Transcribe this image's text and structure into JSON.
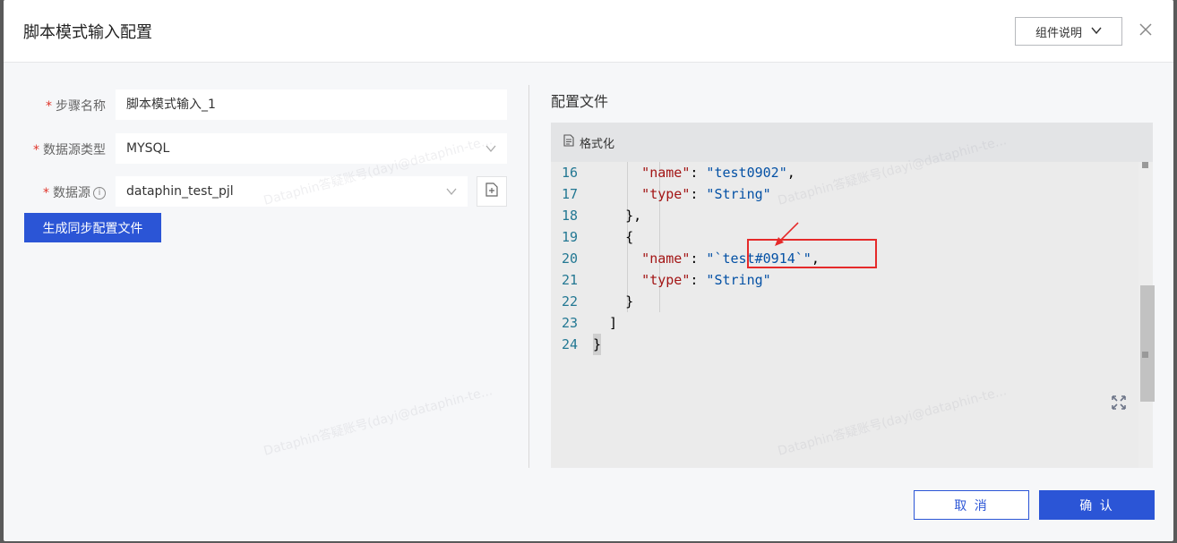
{
  "dialog": {
    "title": "脚本模式输入配置",
    "doc_button": "组件说明",
    "close_icon": "close-icon"
  },
  "form": {
    "step_name": {
      "label": "步骤名称",
      "value": "脚本模式输入_1"
    },
    "datasource_type": {
      "label": "数据源类型",
      "value": "MYSQL"
    },
    "datasource": {
      "label": "数据源",
      "value": "dataphin_test_pjl"
    },
    "generate_button": "生成同步配置文件",
    "required_mark": "*"
  },
  "config": {
    "title": "配置文件",
    "format_button": "格式化",
    "lines": [
      {
        "n": "16",
        "indent": 6,
        "key": "\"name\"",
        "sep": ": ",
        "val": "\"test0902\"",
        "tail": ","
      },
      {
        "n": "17",
        "indent": 6,
        "key": "\"type\"",
        "sep": ": ",
        "val": "\"String\"",
        "tail": ""
      },
      {
        "n": "18",
        "indent": 4,
        "key": "",
        "sep": "",
        "val": "",
        "tail": "},"
      },
      {
        "n": "19",
        "indent": 4,
        "key": "",
        "sep": "",
        "val": "",
        "tail": "{"
      },
      {
        "n": "20",
        "indent": 6,
        "key": "\"name\"",
        "sep": ": ",
        "val": "\"`test#0914`\"",
        "tail": ","
      },
      {
        "n": "21",
        "indent": 6,
        "key": "\"type\"",
        "sep": ": ",
        "val": "\"String\"",
        "tail": ""
      },
      {
        "n": "22",
        "indent": 4,
        "key": "",
        "sep": "",
        "val": "",
        "tail": "}"
      },
      {
        "n": "23",
        "indent": 2,
        "key": "",
        "sep": "",
        "val": "",
        "tail": "]"
      },
      {
        "n": "24",
        "indent": 0,
        "key": "",
        "sep": "",
        "val": "",
        "tail": "}"
      }
    ]
  },
  "footer": {
    "cancel": "取 消",
    "ok": "确 认"
  },
  "watermark": "Dataphin答疑账号(dayi@dataphin-te..."
}
